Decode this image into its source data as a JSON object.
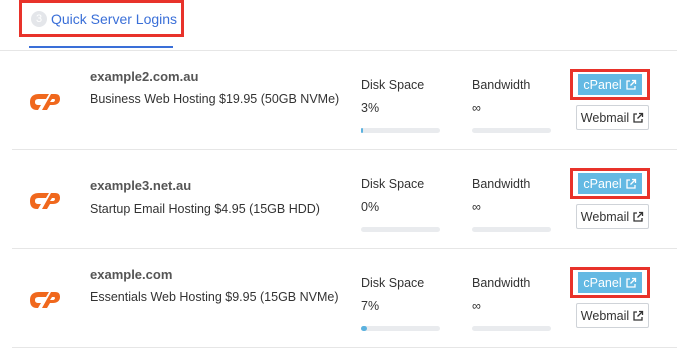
{
  "tab": {
    "number": "3",
    "label": "Quick Server Logins"
  },
  "colors": {
    "accent": "#3a6fd8",
    "cpanel_orange": "#f0681d",
    "bar_fill": "#5cb2df",
    "highlight": "#e8322a"
  },
  "metric_labels": {
    "disk": "Disk Space",
    "bandwidth": "Bandwidth"
  },
  "buttons": {
    "cpanel": "cPanel",
    "webmail": "Webmail"
  },
  "icons": {
    "logo": "cpanel-logo-icon",
    "external": "external-link-icon"
  },
  "servers": [
    {
      "domain": "example2.com.au",
      "plan": "Business Web Hosting $19.95 (50GB NVMe)",
      "disk": "3%",
      "disk_fraction": 0.03,
      "bandwidth": "∞"
    },
    {
      "domain": "example3.net.au",
      "plan": "Startup Email Hosting $4.95 (15GB HDD)",
      "disk": "0%",
      "disk_fraction": 0.0,
      "bandwidth": "∞"
    },
    {
      "domain": "example.com",
      "plan": "Essentials Web Hosting $9.95 (15GB NVMe)",
      "disk": "7%",
      "disk_fraction": 0.07,
      "bandwidth": "∞"
    }
  ]
}
